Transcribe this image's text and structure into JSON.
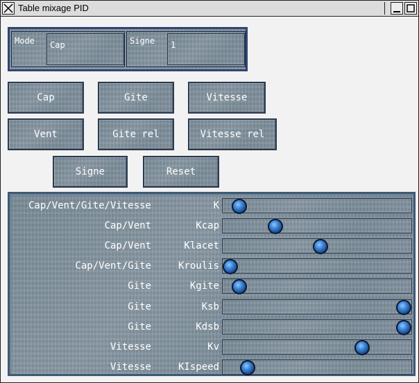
{
  "window": {
    "title": "Table mixage PID"
  },
  "fields": {
    "mode_label": "Mode",
    "mode_value": "Cap",
    "signe_label": "Signe",
    "signe_value": "1"
  },
  "buttons": {
    "cap": "Cap",
    "gite": "Gite",
    "vitesse": "Vitesse",
    "vent": "Vent",
    "gite_rel": "Gite rel",
    "vitesse_rel": "Vitesse rel",
    "signe": "Signe",
    "reset": "Reset"
  },
  "sliders": [
    {
      "label": "Cap/Vent/Gite/Vitesse",
      "param": "K",
      "value": 0.05
    },
    {
      "label": "Cap/Vent",
      "param": "Kcap",
      "value": 0.26
    },
    {
      "label": "Cap/Vent",
      "param": "Klacet",
      "value": 0.52
    },
    {
      "label": "Cap/Vent/Gite",
      "param": "Kroulis",
      "value": 0.0
    },
    {
      "label": "Gite",
      "param": "Kgite",
      "value": 0.05
    },
    {
      "label": "Gite",
      "param": "Ksb",
      "value": 1.0
    },
    {
      "label": "Gite",
      "param": "Kdsb",
      "value": 1.0
    },
    {
      "label": "Vitesse",
      "param": "Kv",
      "value": 0.76
    },
    {
      "label": "Vitesse",
      "param": "KIspeed",
      "value": 0.1
    }
  ],
  "colors": {
    "panel_border": "#2f4473",
    "knob": "#3f86d8"
  }
}
